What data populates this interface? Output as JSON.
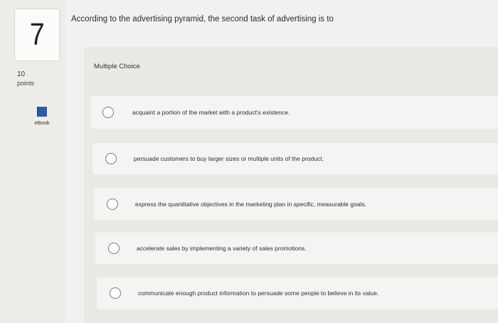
{
  "question": {
    "number": "7",
    "points_value": "10",
    "points_label": "points",
    "ebook_label": "eBook",
    "prompt": "According to the advertising pyramid, the second task of advertising is to",
    "type_label": "Multiple Choice",
    "options": [
      {
        "text": "acquaint a portion of the market with a product's existence."
      },
      {
        "text": "persuade customers to buy larger sizes or multiple units of the product."
      },
      {
        "text": "express the quantitative objectives in the marketing plan in specific, measurable goals."
      },
      {
        "text": "accelerate sales by implementing a variety of sales promotions."
      },
      {
        "text": "communicate enough product information to persuade some people to believe in its value."
      }
    ]
  }
}
